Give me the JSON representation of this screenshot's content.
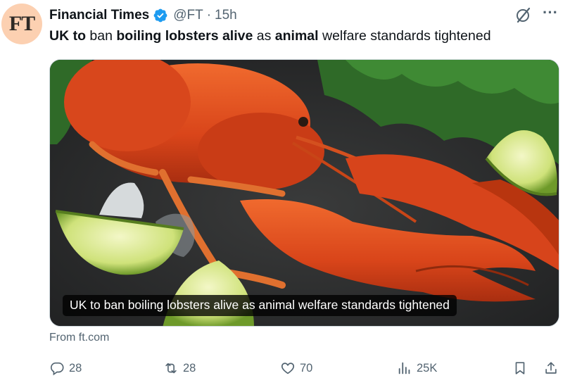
{
  "author": {
    "avatar_text": "FT",
    "name": "Financial Times",
    "handle": "@FT",
    "separator": "·",
    "time": "15h"
  },
  "tweet": {
    "segments": [
      {
        "text": "UK to",
        "bold": true
      },
      {
        "text": " ban ",
        "bold": false
      },
      {
        "text": "boiling lobsters alive",
        "bold": true
      },
      {
        "text": " as ",
        "bold": false
      },
      {
        "text": "animal",
        "bold": true
      },
      {
        "text": " welfare standards tightened",
        "bold": false
      }
    ]
  },
  "media": {
    "caption": "UK to ban boiling lobsters alive as animal welfare standards tightened"
  },
  "source": "From ft.com",
  "actions": {
    "replies": "28",
    "reposts": "28",
    "likes": "70",
    "views": "25K"
  },
  "icons": {
    "verified": "verified-badge-icon",
    "grok": "grok-icon",
    "more": "more-icon",
    "reply": "reply-icon",
    "repost": "repost-icon",
    "like": "heart-icon",
    "views": "views-icon",
    "bookmark": "bookmark-icon",
    "share": "share-icon"
  },
  "colors": {
    "text": "#0f1419",
    "secondary": "#536471",
    "verified": "#1d9bf0",
    "avatar_bg": "#fcd0b1"
  }
}
